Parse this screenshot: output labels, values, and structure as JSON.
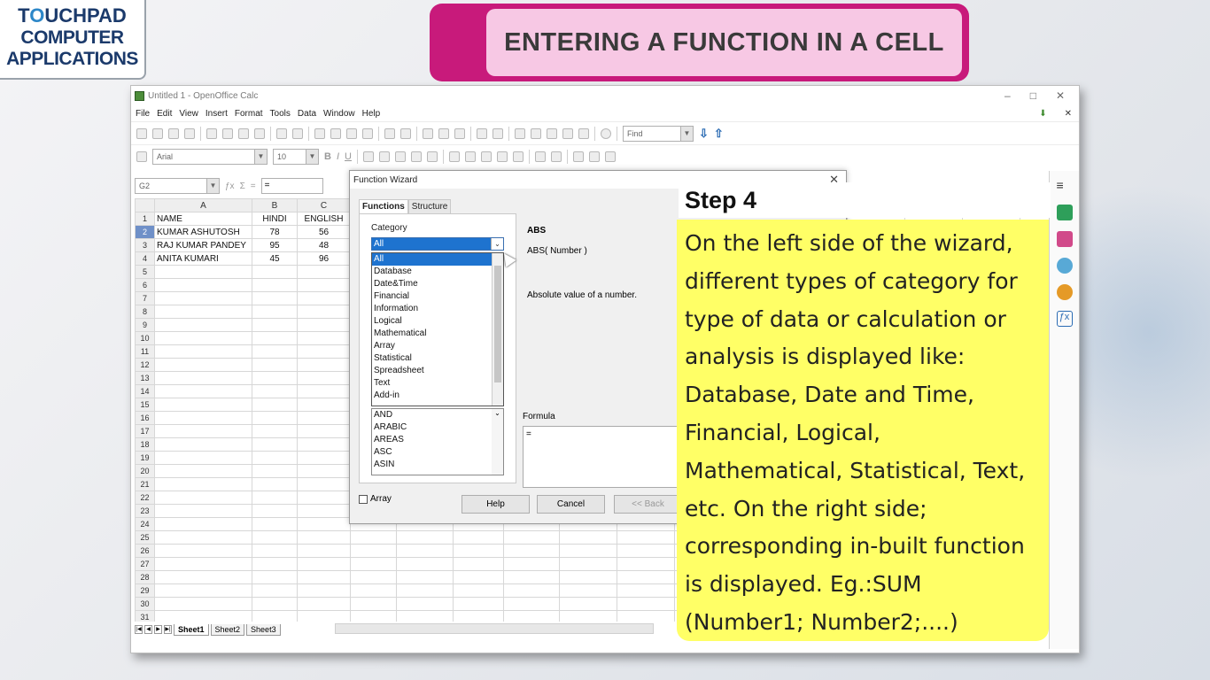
{
  "logo": {
    "line1a": "T",
    "line1b": "O",
    "line1c": "UCHPAD",
    "line2": "COMPUTER",
    "line3": "APPLICATIONS"
  },
  "banner": {
    "title": "ENTERING A FUNCTION IN A CELL"
  },
  "window": {
    "title": "Untitled 1 - OpenOffice Calc",
    "controls": [
      "–",
      "□",
      "✕"
    ],
    "menus": [
      "File",
      "Edit",
      "View",
      "Insert",
      "Format",
      "Tools",
      "Data",
      "Window",
      "Help"
    ],
    "find_placeholder": "Find",
    "font_name": "Arial",
    "font_size": "10",
    "name_box": "G2",
    "formula": "="
  },
  "sheet": {
    "columns": [
      "A",
      "B",
      "C"
    ],
    "rows": [
      [
        "NAME",
        "HINDI",
        "ENGLISH"
      ],
      [
        "KUMAR ASHUTOSH",
        "78",
        "56"
      ],
      [
        "RAJ KUMAR PANDEY",
        "95",
        "48"
      ],
      [
        "ANITA KUMARI",
        "45",
        "96"
      ]
    ],
    "row_count": 31,
    "tabs": [
      "Sheet1",
      "Sheet2",
      "Sheet3"
    ],
    "active_tab": "Sheet1"
  },
  "wizard": {
    "title": "Function Wizard",
    "close": "✕",
    "tabs": [
      "Functions",
      "Structure"
    ],
    "category_label": "Category",
    "category_selected": "All",
    "category_options": [
      "All",
      "Database",
      "Date&Time",
      "Financial",
      "Information",
      "Logical",
      "Mathematical",
      "Array",
      "Statistical",
      "Spreadsheet",
      "Text",
      "Add-in"
    ],
    "functions": [
      "AND",
      "ARABIC",
      "AREAS",
      "ASC",
      "ASIN"
    ],
    "function_name": "ABS",
    "function_signature": "ABS( Number )",
    "function_description": "Absolute value of a number.",
    "formula_label": "Formula",
    "formula_value": "=",
    "array_label": "Array",
    "buttons": {
      "help": "Help",
      "cancel": "Cancel",
      "back": "<< Back"
    }
  },
  "step": {
    "title": "Step 4",
    "text": "On the left side of the wizard, different types of category for type of data or calculation or analysis is displayed like: Database, Date and Time, Financial, Logical, Mathematical, Statistical, Text, etc. On the right side; corresponding in-built function is displayed. Eg.:SUM (Number1; Number2;....)"
  }
}
